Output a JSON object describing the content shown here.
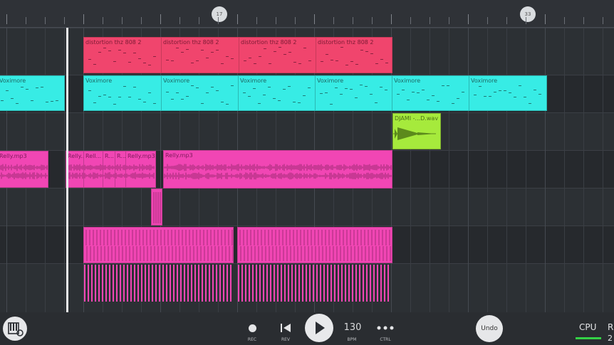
{
  "ruler": {
    "marker_1": "17",
    "marker_2": "33"
  },
  "clips": {
    "distortion": [
      "distortion thz 808 2",
      "distortion thz 808 2",
      "distortion thz 808 2",
      "distortion thz 808 2"
    ],
    "voximore": [
      "Voximore",
      "Voximore",
      "Voximore",
      "Voximore",
      "Voximore",
      "Voximore",
      "Voximore"
    ],
    "djami": "DJAMI -...D.wav",
    "relly": [
      "Relly.mp3",
      "Relly...",
      "Rell...",
      "R...",
      "R...",
      "Relly.mp3",
      "Relly.mp3"
    ]
  },
  "transport": {
    "rec": "REC",
    "rev": "REV",
    "bpm_value": "130",
    "bpm": "BPM",
    "ctrl": "CTRL",
    "undo": "Undo",
    "cpu": "CPU",
    "edge_r": "R",
    "edge_2": "2"
  },
  "colors": {
    "red_clip": "#f0456d",
    "cyan_clip": "#37ece5",
    "green_clip": "#a6ea3c",
    "pink_clip": "#f146b4",
    "cpu_meter": "#34d146"
  }
}
